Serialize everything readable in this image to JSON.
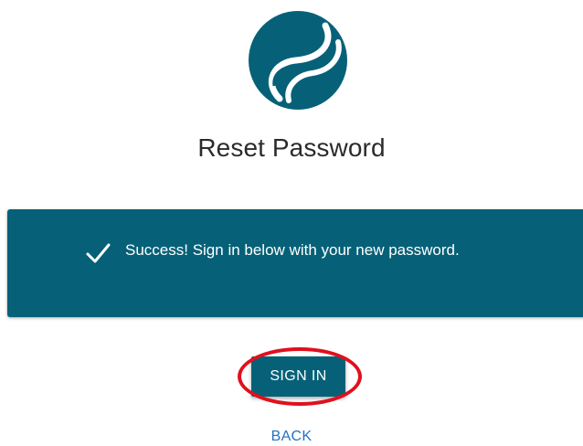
{
  "logo": {
    "icon": "brand-logo-icon",
    "color": "#066178"
  },
  "page": {
    "title": "Reset Password"
  },
  "banner": {
    "icon": "checkmark-icon",
    "message": "Success! Sign in below with your new password.",
    "background": "#066178"
  },
  "actions": {
    "sign_in_label": "SIGN IN",
    "back_label": "BACK",
    "highlight_color": "#e0101d"
  }
}
